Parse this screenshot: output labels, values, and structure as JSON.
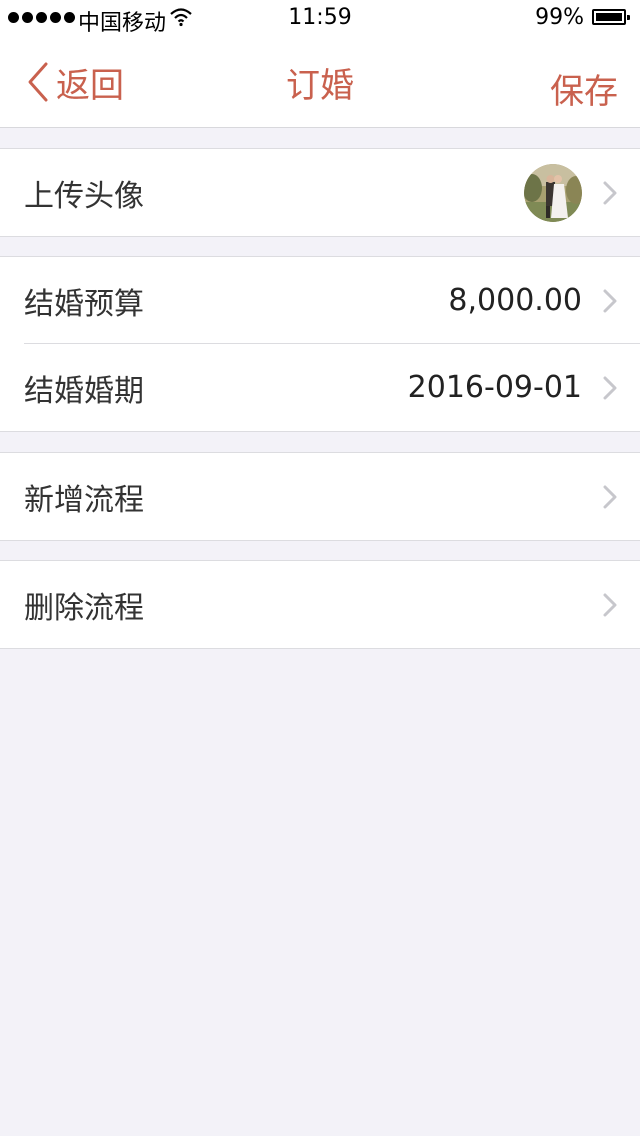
{
  "status": {
    "carrier": "中国移动",
    "time": "11:59",
    "battery": "99%"
  },
  "nav": {
    "back_label": "返回",
    "title": "订婚",
    "save_label": "保存"
  },
  "rows": {
    "avatar": {
      "label": "上传头像"
    },
    "budget": {
      "label": "结婚预算",
      "value": "8,000.00"
    },
    "date": {
      "label": "结婚婚期",
      "value": "2016-09-01"
    },
    "add_flow": {
      "label": "新增流程"
    },
    "delete_flow": {
      "label": "删除流程"
    }
  },
  "colors": {
    "accent": "#c9614e",
    "background": "#f3f2f8",
    "chevron": "#c7c7cc"
  },
  "icons": [
    "back-chevron-icon",
    "wifi-icon",
    "battery-icon",
    "chevron-right-icon"
  ]
}
